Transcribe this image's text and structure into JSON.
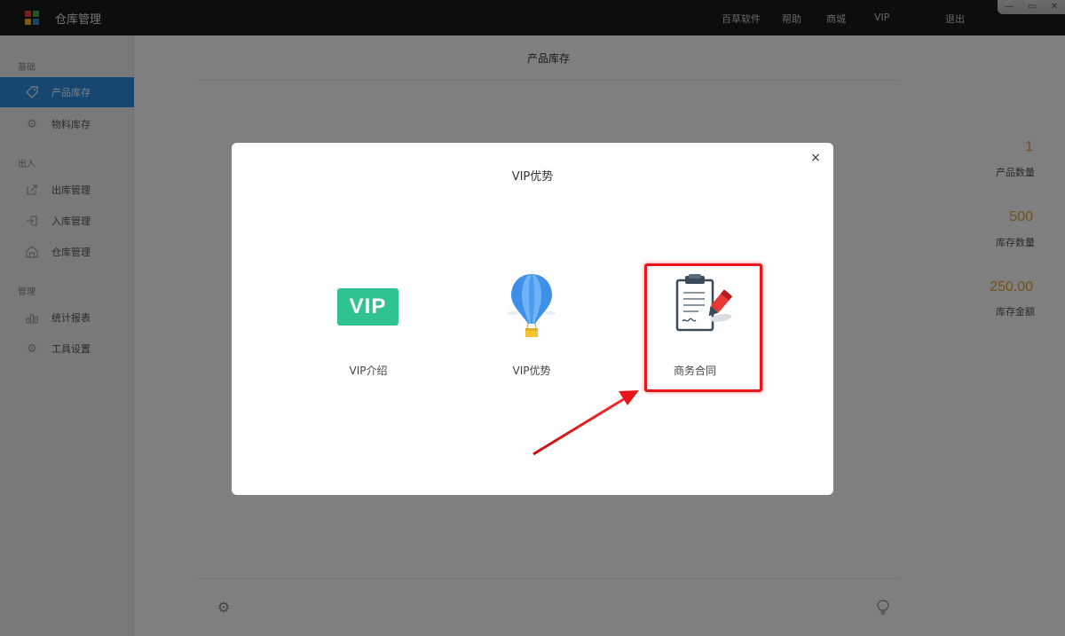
{
  "app": {
    "title": "仓库管理",
    "logo_colors": [
      "#e8413a",
      "#3db14a",
      "#f3b22b",
      "#2e86de"
    ]
  },
  "topnav": {
    "items": [
      "百草软件",
      "帮助",
      "商城",
      "VIP",
      "退出"
    ]
  },
  "window_controls": [
    "—",
    "▭",
    "✕"
  ],
  "sidebar": {
    "sections": [
      {
        "label": "基础",
        "items": [
          {
            "label": "产品库存",
            "icon": "tag-icon",
            "active": true
          },
          {
            "label": "物料库存",
            "icon": "gear-icon",
            "active": false
          }
        ]
      },
      {
        "label": "出入",
        "items": [
          {
            "label": "出库管理",
            "icon": "export-icon",
            "active": false
          },
          {
            "label": "入库管理",
            "icon": "import-icon",
            "active": false
          },
          {
            "label": "仓库管理",
            "icon": "warehouse-icon",
            "active": false
          }
        ]
      },
      {
        "label": "管理",
        "items": [
          {
            "label": "统计报表",
            "icon": "chart-icon",
            "active": false
          },
          {
            "label": "工具设置",
            "icon": "settings-icon",
            "active": false
          }
        ]
      }
    ]
  },
  "main": {
    "title": "产品库存",
    "stats": [
      {
        "value": "1",
        "label": "产品数量"
      },
      {
        "value": "500",
        "label": "库存数量"
      },
      {
        "value": "250.00",
        "label": "库存金额"
      }
    ],
    "footer_icons": [
      "settings-icon",
      "lightbulb-icon"
    ]
  },
  "modal": {
    "title": "VIP优势",
    "close": "×",
    "options": [
      {
        "badge": "VIP",
        "label": "VIP介绍",
        "icon": "vip-badge-icon"
      },
      {
        "label": "VIP优势",
        "icon": "hot-air-balloon-icon"
      },
      {
        "label": "商务合同",
        "icon": "contract-clipboard-icon"
      }
    ]
  },
  "colors": {
    "accent": "#2f8fe0",
    "stat": "#e8a23a",
    "vip_green": "#2fc48f",
    "highlight": "#e8161a"
  }
}
